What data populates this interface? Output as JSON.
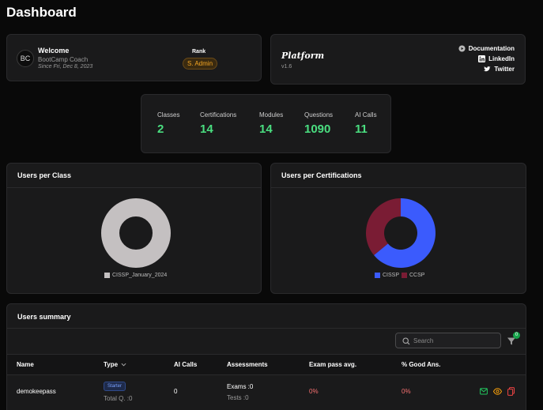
{
  "header": {
    "title": "Dashboard"
  },
  "welcome": {
    "avatar": "BC",
    "title": "Welcome",
    "role": "BootCamp Coach",
    "since": "Since Fri, Dec 8, 2023",
    "rank_label": "Rank",
    "rank_value": "S. Admin"
  },
  "platform": {
    "name": "Platform",
    "version": "v1.6",
    "links": [
      "Documentation",
      "LinkedIn",
      "Twitter"
    ]
  },
  "stats": [
    {
      "label": "Classes",
      "value": "2"
    },
    {
      "label": "Certifications",
      "value": "14"
    },
    {
      "label": "Modules",
      "value": "14"
    },
    {
      "label": "Questions",
      "value": "1090"
    },
    {
      "label": "AI Calls",
      "value": "11"
    }
  ],
  "chart_data": [
    {
      "type": "pie",
      "title": "Users per Class",
      "categories": [
        "CISSP_January_2024"
      ],
      "values": [
        100
      ],
      "colors": [
        "#c4c0c1"
      ]
    },
    {
      "type": "pie",
      "title": "Users per Certifications",
      "categories": [
        "CISSP",
        "CCSP"
      ],
      "values": [
        64,
        36
      ],
      "colors": [
        "#3b5bfd",
        "#7a1c34"
      ]
    }
  ],
  "summary": {
    "title": "Users summary",
    "search_placeholder": "Search",
    "filter_count": "0",
    "columns": [
      "Name",
      "Type",
      "AI Calls",
      "Assessments",
      "Exam pass avg.",
      "% Good Ans."
    ],
    "rows": [
      {
        "name": "demokeepass",
        "type_badge": "Starter",
        "total_q": "Total Q. :0",
        "ai_calls": "0",
        "exams": "Exams :0",
        "tests": "Tests :0",
        "exam_pass": "0%",
        "good_ans": "0%"
      }
    ]
  },
  "colors": {
    "accent_green": "#4ade80",
    "danger": "#f87171",
    "rank": "#f5a623"
  }
}
